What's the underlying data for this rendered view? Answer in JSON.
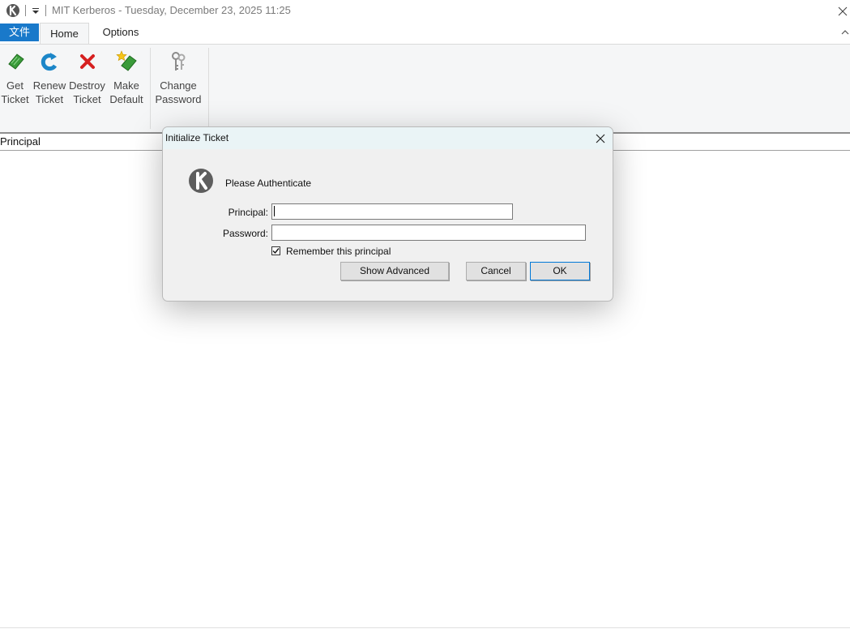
{
  "window": {
    "title": "MIT Kerberos - Tuesday, December 23, 2025  11:25"
  },
  "ribbon": {
    "tabs": [
      "文件",
      "Home",
      "Options"
    ],
    "buttons": [
      {
        "line1": "Get",
        "line2": "Ticket",
        "icon": "green-ticket-icon"
      },
      {
        "line1": "Renew",
        "line2": "Ticket",
        "icon": "renew-arrow-icon"
      },
      {
        "line1": "Destroy",
        "line2": "Ticket",
        "icon": "red-x-icon"
      },
      {
        "line1": "Make",
        "line2": "Default",
        "icon": "star-ticket-icon"
      },
      {
        "line1": "Change",
        "line2": "Password",
        "icon": "keys-icon"
      }
    ]
  },
  "list": {
    "columns": [
      "Principal"
    ]
  },
  "dialog": {
    "title": "Initialize Ticket",
    "heading": "Please Authenticate",
    "principal_label": "Principal:",
    "principal_value": "",
    "password_label": "Password:",
    "password_value": "",
    "remember_label": "Remember this principal",
    "remember_checked": true,
    "show_advanced_label": "Show Advanced",
    "cancel_label": "Cancel",
    "ok_label": "OK"
  },
  "colors": {
    "file_tab": "#1979ca",
    "ribbon_bg": "#f5f6f7",
    "dialog_bg": "#f0f0f0",
    "dialog_title_bg": "#eaf4f6"
  }
}
